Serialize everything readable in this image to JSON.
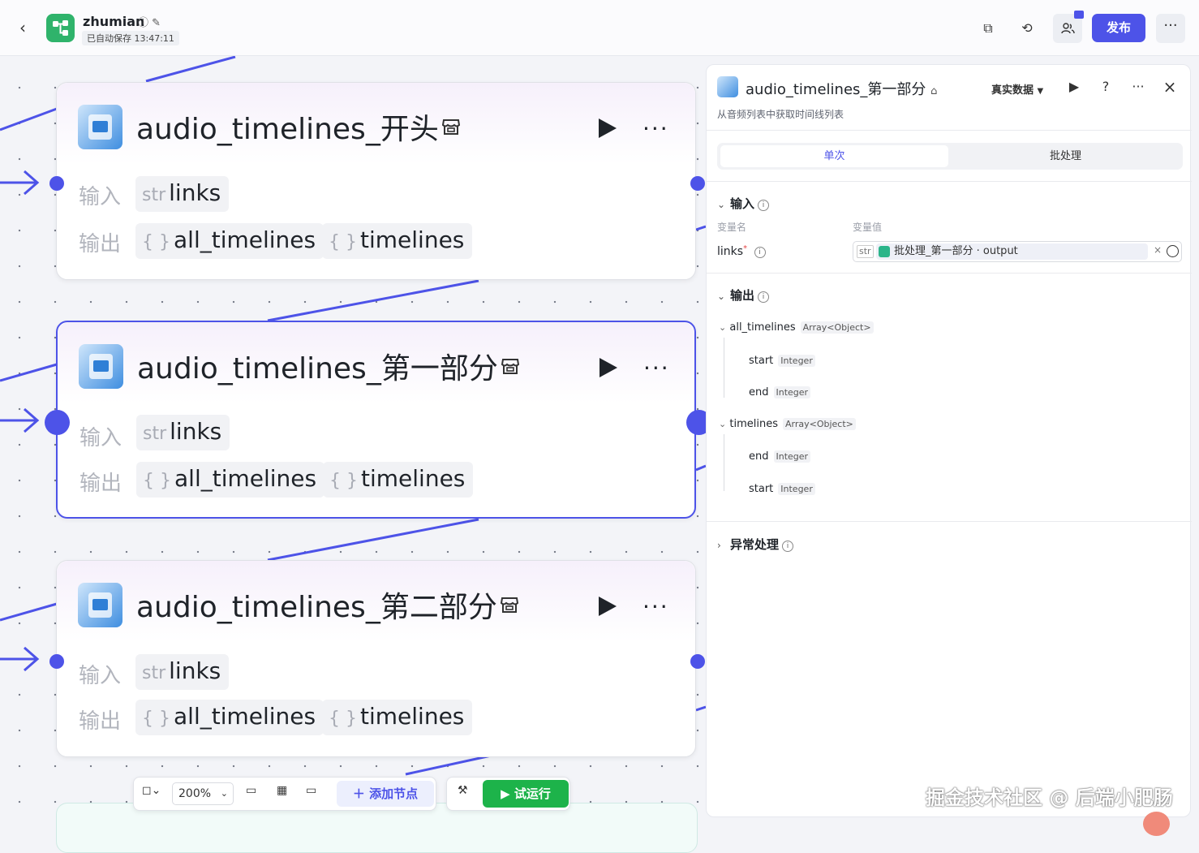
{
  "header": {
    "app_name": "zhumian",
    "autosave": "已自动保存 13:47:11",
    "publish": "发布"
  },
  "nodes": [
    {
      "title": "audio_timelines_开头",
      "in_label": "输入",
      "out_label": "输出",
      "input": "links",
      "input_type": "str",
      "outputs": [
        "all_timelines",
        "timelines"
      ],
      "selected": false
    },
    {
      "title": "audio_timelines_第一部分",
      "in_label": "输入",
      "out_label": "输出",
      "input": "links",
      "input_type": "str",
      "outputs": [
        "all_timelines",
        "timelines"
      ],
      "selected": true
    },
    {
      "title": "audio_timelines_第二部分",
      "in_label": "输入",
      "out_label": "输出",
      "input": "links",
      "input_type": "str",
      "outputs": [
        "all_timelines",
        "timelines"
      ],
      "selected": false
    }
  ],
  "obj_type_glyph": "{ }",
  "panel": {
    "title": "audio_timelines_第一部分",
    "description": "从音频列表中获取时间线列表",
    "data_mode": "真实数据",
    "tabs": [
      "单次",
      "批处理"
    ],
    "input_section": "输入",
    "col_name": "变量名",
    "col_value": "变量值",
    "input_name": "links",
    "input_type": "str",
    "input_value": "批处理_第一部分 · output",
    "output_section": "输出",
    "outputs": [
      {
        "name": "all_timelines",
        "type": "Array<Object>",
        "children": [
          {
            "name": "start",
            "type": "Integer"
          },
          {
            "name": "end",
            "type": "Integer"
          }
        ]
      },
      {
        "name": "timelines",
        "type": "Array<Object>",
        "children": [
          {
            "name": "end",
            "type": "Integer"
          },
          {
            "name": "start",
            "type": "Integer"
          }
        ]
      }
    ],
    "error_section": "异常处理"
  },
  "toolbar": {
    "zoom": "200%",
    "add_node": "添加节点",
    "trial_run": "试运行"
  },
  "watermark": "掘金技术社区 @ 后端小肥肠",
  "colors": {
    "accent": "#4d53e8",
    "green": "#1db34a"
  }
}
